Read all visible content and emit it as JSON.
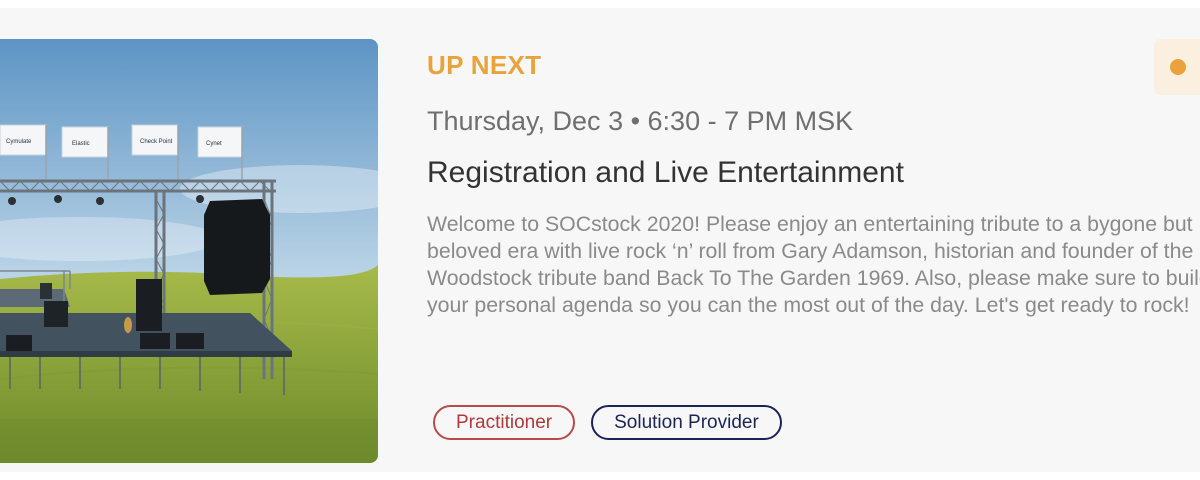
{
  "session": {
    "label": "UP NEXT",
    "datetime": "Thursday, Dec 3 • 6:30 - 7 PM MSK",
    "title": "Registration and Live Entertainment",
    "description": "Welcome to SOCstock 2020! Please enjoy an entertaining tribute to a bygone but beloved era with live rock ‘n’ roll from Gary Adamson, historian and founder of the Woodstock tribute band Back To The Garden 1969. Also, please make sure to build your personal agenda so you can the most out of the day. Let's get ready to rock!",
    "tags": [
      {
        "label": "Practitioner",
        "color": "#b03a3a"
      },
      {
        "label": "Solution Provider",
        "color": "#1c2456"
      }
    ]
  },
  "hero_image": {
    "flags": [
      "Cymulate",
      "Elastic",
      "Check Point",
      "Cynet"
    ]
  },
  "colors": {
    "accent": "#e8a33d",
    "card_background": "#f7f7f7"
  },
  "icons": {
    "status_indicator": "orange-dot-icon"
  }
}
